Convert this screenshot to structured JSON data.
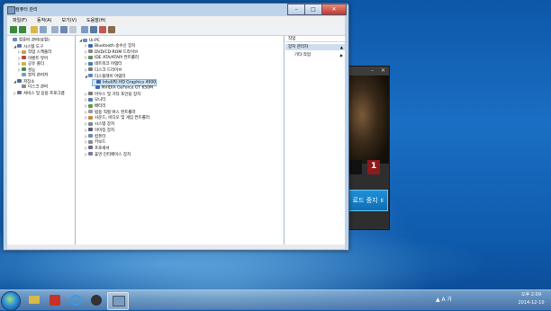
{
  "window": {
    "title": "컴퓨터 관리",
    "buttons": {
      "minimize": "–",
      "maximize": "□",
      "close": "✕"
    }
  },
  "menu": [
    "파일(F)",
    "동작(A)",
    "보기(V)",
    "도움말(H)"
  ],
  "left_tree": [
    {
      "label": "컴퓨터 관리(로컬)",
      "level": 0,
      "expander": ""
    },
    {
      "label": "시스템 도구",
      "level": 1,
      "expander": "◢"
    },
    {
      "label": "작업 스케줄러",
      "level": 2,
      "expander": "▷"
    },
    {
      "label": "이벤트 뷰어",
      "level": 2,
      "expander": "▷"
    },
    {
      "label": "공유 폴더",
      "level": 2,
      "expander": "▷"
    },
    {
      "label": "성능",
      "level": 2,
      "expander": "▷"
    },
    {
      "label": "장치 관리자",
      "level": 2,
      "expander": ""
    },
    {
      "label": "저장소",
      "level": 1,
      "expander": "◢"
    },
    {
      "label": "디스크 관리",
      "level": 2,
      "expander": ""
    },
    {
      "label": "서비스 및 응용 프로그램",
      "level": 1,
      "expander": "▷"
    }
  ],
  "device_tree": {
    "root": "Ui-PC",
    "items": [
      {
        "label": "Bluetooth 송수신 장치",
        "level": 1,
        "expander": "▷"
      },
      {
        "label": "DVD/CD-ROM 드라이브",
        "level": 1,
        "expander": "▷"
      },
      {
        "label": "IDE ATA/ATAPI 컨트롤러",
        "level": 1,
        "expander": "▷"
      },
      {
        "label": "네트워크 어댑터",
        "level": 1,
        "expander": "▷"
      },
      {
        "label": "디스크 드라이브",
        "level": 1,
        "expander": "▷"
      },
      {
        "label": "디스플레이 어댑터",
        "level": 1,
        "expander": "◢"
      },
      {
        "label": "Intel(R) HD Graphics 4000",
        "level": 2,
        "expander": "",
        "selected": true
      },
      {
        "label": "NVIDIA GeForce GT 650M",
        "level": 2,
        "expander": ""
      },
      {
        "label": "마우스 및 기타 포인팅 장치",
        "level": 1,
        "expander": "▷"
      },
      {
        "label": "모니터",
        "level": 1,
        "expander": "▷"
      },
      {
        "label": "배터리",
        "level": 1,
        "expander": "▷"
      },
      {
        "label": "범용 직렬 버스 컨트롤러",
        "level": 1,
        "expander": "▷"
      },
      {
        "label": "사운드, 비디오 및 게임 컨트롤러",
        "level": 1,
        "expander": "▷"
      },
      {
        "label": "시스템 장치",
        "level": 1,
        "expander": "▷"
      },
      {
        "label": "이미징 장치",
        "level": 1,
        "expander": "▷"
      },
      {
        "label": "컴퓨터",
        "level": 1,
        "expander": "▷"
      },
      {
        "label": "키보드",
        "level": 1,
        "expander": "▷"
      },
      {
        "label": "프로세서",
        "level": 1,
        "expander": "▷"
      },
      {
        "label": "휴먼 인터페이스 장치",
        "level": 1,
        "expander": "▷"
      }
    ]
  },
  "actions": {
    "header": "작업",
    "section": "장치 관리자",
    "more": "기타 작업"
  },
  "game_window": {
    "button_label": "로드 중지 ॥",
    "tile_text": "1"
  },
  "taskbar": {
    "apps": [
      "explorer-icon",
      "music-player-icon",
      "internet-explorer-icon",
      "kakao-talk-icon",
      "computer-management-icon"
    ],
    "tray": "▲ A 가",
    "time": "오후 2:09",
    "date": "2014-12-10"
  },
  "colors": {
    "desktop": "#1565b8",
    "selection": "#cce4f7",
    "close_button": "#c0382a",
    "game_button": "#1478c2"
  }
}
